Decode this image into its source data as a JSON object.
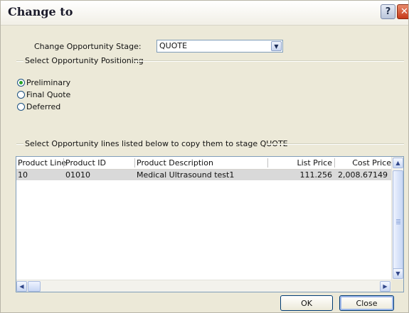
{
  "window": {
    "title": "Change to",
    "help_icon": "?",
    "close_icon": "✕"
  },
  "stage": {
    "label": "Change Opportunity Stage:",
    "value": "QUOTE"
  },
  "positioning": {
    "group_label": "Select Opportunity Positioning",
    "options": [
      {
        "label": "Preliminary",
        "checked": true
      },
      {
        "label": "Final Quote",
        "checked": false
      },
      {
        "label": "Deferred",
        "checked": false
      }
    ]
  },
  "lines": {
    "group_label": "Select Opportunity lines listed below to copy them to stage QUOTE",
    "columns": [
      "Product Line",
      "Product ID",
      "Product Description",
      "List Price",
      "Cost Price"
    ],
    "rows": [
      {
        "product_line": "10",
        "product_id": "01010",
        "description": "Medical Ultrasound test1",
        "list_price": "111.256",
        "cost_price": "2,008.67149"
      }
    ]
  },
  "buttons": {
    "ok": "OK",
    "close": "Close"
  }
}
